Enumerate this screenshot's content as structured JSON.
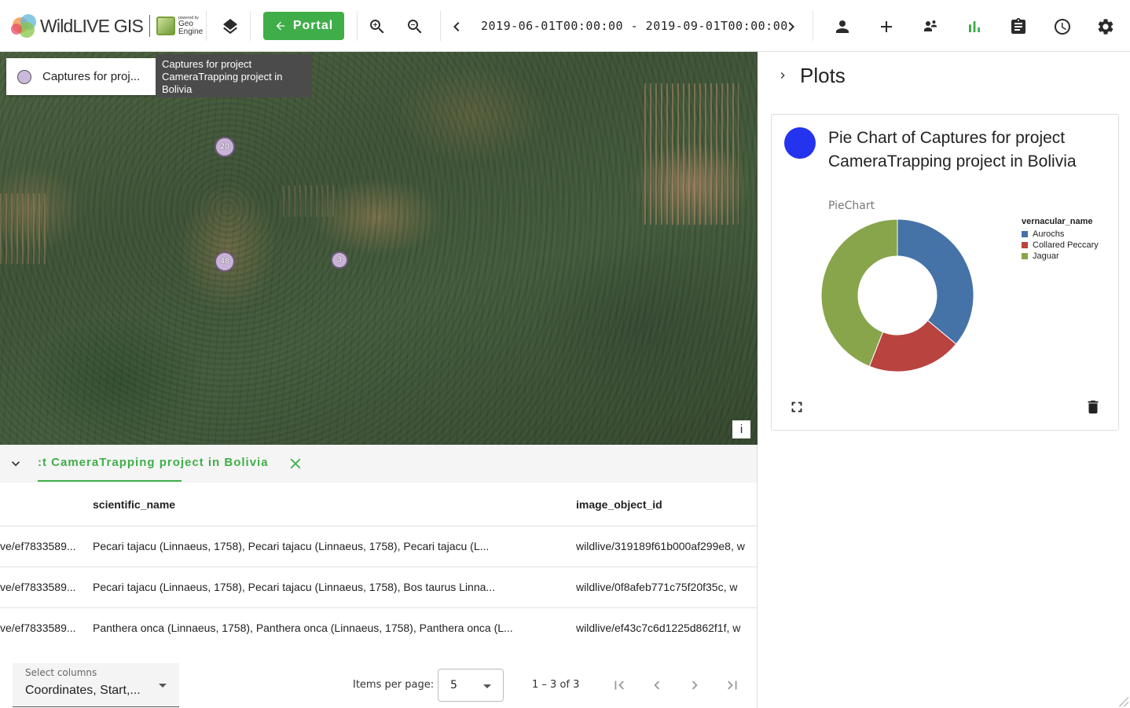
{
  "app": {
    "logo_text": "WildLIVE GIS",
    "powered_by": "powered by",
    "engine_line1": "Geo",
    "engine_line2": "Engine"
  },
  "toolbar": {
    "portal_label": "Portal",
    "time_range": "2019-06-01T00:00:00 - 2019-09-01T00:00:00",
    "icons": [
      "layers-icon",
      "zoom-in-icon",
      "zoom-out-icon",
      "chevron-left-icon",
      "chevron-right-icon",
      "user-icon",
      "add-icon",
      "operators-icon",
      "plots-icon",
      "clipboard-icon",
      "history-icon",
      "settings-icon"
    ],
    "active_color": "#3fae49"
  },
  "map": {
    "layer_label": "Captures for proj...",
    "tooltip": "Captures for project CameraTrapping project in Bolivia",
    "clusters": [
      "20",
      "48",
      "3"
    ],
    "info_label": "i"
  },
  "table": {
    "tab_label": ":t CameraTrapping project in Bolivia",
    "columns": [
      "scientific_name",
      "image_object_id"
    ],
    "rows": [
      {
        "id": "ve/ef7833589...",
        "scientific_name": "Pecari tajacu (Linnaeus, 1758), Pecari tajacu (Linnaeus, 1758), Pecari tajacu (L...",
        "image_object_id": "wildlive/319189f61b000af299e8, w"
      },
      {
        "id": "ve/ef7833589...",
        "scientific_name": "Pecari tajacu (Linnaeus, 1758), Pecari tajacu (Linnaeus, 1758), Bos taurus Linna...",
        "image_object_id": "wildlive/0f8afeb771c75f20f35c, w"
      },
      {
        "id": "ve/ef7833589...",
        "scientific_name": "Panthera onca (Linnaeus, 1758), Panthera onca (Linnaeus, 1758), Panthera onca (L...",
        "image_object_id": "wildlive/ef43c7c6d1225d862f1f, w"
      }
    ],
    "select_columns_label": "Select columns",
    "select_columns_value": "Coordinates, Start,...",
    "items_per_page_label": "Items per page:",
    "items_per_page_value": "5",
    "range_label": "1 – 3 of 3"
  },
  "plots_panel": {
    "title": "Plots",
    "card": {
      "title": "Pie Chart of Captures for project CameraTrapping project in Bolivia",
      "subtitle": "PieChart",
      "avatar_color": "#2333ee"
    }
  },
  "chart_data": {
    "type": "pie",
    "legend_title": "vernacular_name",
    "donut": true,
    "legend_placement": "right",
    "categories": [
      "Aurochs",
      "Collared Peccary",
      "Jaguar"
    ],
    "values": [
      36,
      20,
      44
    ],
    "colors": [
      "#4572a7",
      "#b9433f",
      "#88a54b"
    ]
  }
}
